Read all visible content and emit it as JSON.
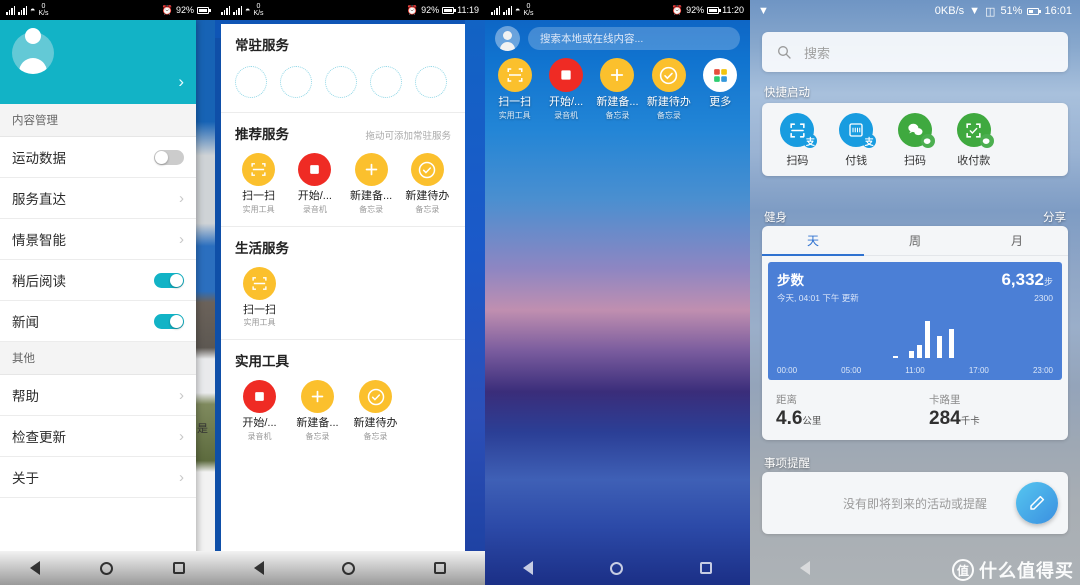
{
  "panel1": {
    "statusbar": {
      "network": "0 K/s",
      "battery": "92%"
    },
    "profile": {
      "chevron": "›"
    },
    "sections": [
      {
        "title": "内容管理",
        "rows": [
          {
            "label": "运动数据",
            "control": "toggle",
            "state": "off"
          },
          {
            "label": "服务直达",
            "control": "chevron",
            "chevron": "›"
          },
          {
            "label": "情景智能",
            "control": "chevron",
            "chevron": "›"
          },
          {
            "label": "稍后阅读",
            "control": "toggle",
            "state": "on"
          },
          {
            "label": "新闻",
            "control": "toggle",
            "state": "on"
          }
        ]
      },
      {
        "title": "其他",
        "rows": [
          {
            "label": "帮助",
            "control": "chevron",
            "chevron": "›"
          },
          {
            "label": "检查更新",
            "control": "chevron",
            "chevron": "›"
          },
          {
            "label": "关于",
            "control": "chevron",
            "chevron": "›"
          }
        ]
      }
    ],
    "background_text": "是"
  },
  "panel2": {
    "statusbar": {
      "network": "0 K/s",
      "battery": "92%",
      "time": "11:19"
    },
    "groups": [
      {
        "title": "常驻服务",
        "hint": "",
        "type": "placeholders",
        "placeholder_count": 5
      },
      {
        "title": "推荐服务",
        "hint": "拖动可添加常驻服务",
        "type": "apps",
        "apps": [
          {
            "name": "扫一扫",
            "source": "实用工具",
            "icon": "scan-icon",
            "color": "#fbc02d"
          },
          {
            "name": "开始/...",
            "source": "录音机",
            "icon": "stop-icon",
            "color": "#ef2b24"
          },
          {
            "name": "新建备...",
            "source": "备忘录",
            "icon": "plus-icon",
            "color": "#fbc02d"
          },
          {
            "name": "新建待办",
            "source": "备忘录",
            "icon": "check-icon",
            "color": "#fbc02d"
          }
        ]
      },
      {
        "title": "生活服务",
        "hint": "",
        "type": "apps",
        "apps": [
          {
            "name": "扫一扫",
            "source": "实用工具",
            "icon": "scan-icon",
            "color": "#fbc02d"
          }
        ]
      },
      {
        "title": "实用工具",
        "hint": "",
        "type": "apps",
        "apps": [
          {
            "name": "开始/...",
            "source": "录音机",
            "icon": "stop-icon",
            "color": "#ef2b24"
          },
          {
            "name": "新建备...",
            "source": "备忘录",
            "icon": "plus-icon",
            "color": "#fbc02d"
          },
          {
            "name": "新建待办",
            "source": "备忘录",
            "icon": "check-icon",
            "color": "#fbc02d"
          }
        ]
      }
    ]
  },
  "panel3": {
    "statusbar": {
      "network": "0 K/s",
      "battery": "92%",
      "time": "11:20"
    },
    "search": {
      "placeholder": "搜索本地或在线内容..."
    },
    "apps": [
      {
        "name": "扫一扫",
        "source": "实用工具",
        "icon": "scan-icon",
        "color": "#fbc02d"
      },
      {
        "name": "开始/...",
        "source": "录音机",
        "icon": "stop-icon",
        "color": "#ef2b24"
      },
      {
        "name": "新建备...",
        "source": "备忘录",
        "icon": "plus-icon",
        "color": "#fbc02d"
      },
      {
        "name": "新建待办",
        "source": "备忘录",
        "icon": "check-icon",
        "color": "#fbc02d"
      },
      {
        "name": "更多",
        "source": "",
        "icon": "grid-icon",
        "color": "#ffffff"
      }
    ]
  },
  "panel4": {
    "statusbar": {
      "speed": "0KB/s",
      "battery": "51%",
      "time": "16:01"
    },
    "search": {
      "placeholder": "搜索"
    },
    "quick_launch": {
      "title": "快捷启动",
      "items": [
        {
          "label": "扫码",
          "icon": "alipay-scan-icon",
          "color": "#189ce0"
        },
        {
          "label": "付钱",
          "icon": "alipay-pay-icon",
          "color": "#189ce0"
        },
        {
          "label": "扫码",
          "icon": "wechat-scan-icon",
          "color": "#3fa93f"
        },
        {
          "label": "收付款",
          "icon": "wechat-pay-icon",
          "color": "#3fa93f"
        }
      ]
    },
    "fitness": {
      "title": "健身",
      "share_label": "分享",
      "tabs": [
        {
          "label": "天",
          "active": true
        },
        {
          "label": "周",
          "active": false
        },
        {
          "label": "月",
          "active": false
        }
      ],
      "steps_label": "步数",
      "steps_value": "6,332",
      "steps_unit": "步",
      "updated": "今天, 04:01 下午 更新",
      "goal": "2300",
      "metrics": [
        {
          "key": "距离",
          "value": "4.6",
          "unit": "公里"
        },
        {
          "key": "卡路里",
          "value": "284",
          "unit": "千卡"
        }
      ]
    },
    "reminders": {
      "title": "事项提醒",
      "empty_text": "没有即将到来的活动或提醒",
      "fab_icon": "pencil-icon"
    },
    "watermark": {
      "mark": "值",
      "text": "什么值得买"
    }
  },
  "chart_data": {
    "type": "bar",
    "title": "步数",
    "xlabel": "",
    "ylabel": "步数",
    "ylim": [
      0,
      2300
    ],
    "tick_labels": [
      "00:00",
      "05:00",
      "11:00",
      "17:00",
      "23:00"
    ],
    "x": [
      "09:40",
      "11:00",
      "11:40",
      "12:20",
      "13:20",
      "14:20"
    ],
    "values": [
      40,
      330,
      560,
      1650,
      980,
      1280
    ],
    "grid": false,
    "legend": null,
    "annotations": [
      "6,332 步",
      "目标 2300"
    ]
  },
  "navbar": {
    "back": "back-icon",
    "home": "home-icon",
    "recents": "recents-icon"
  }
}
